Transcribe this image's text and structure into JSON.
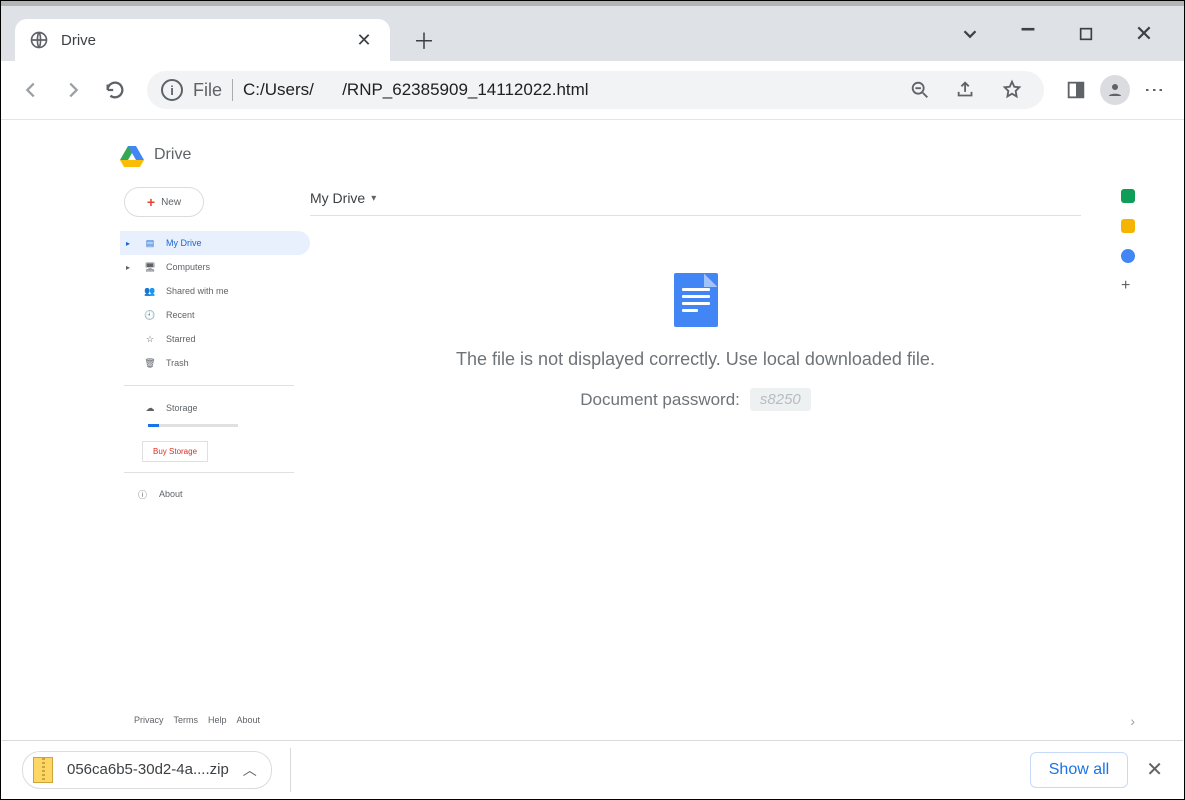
{
  "window": {
    "tab_title": "Drive"
  },
  "omnibox": {
    "scheme": "File",
    "url": "C:/Users/      /RNP_62385909_14112022.html"
  },
  "drive": {
    "brand": "Drive",
    "new_button": "New",
    "breadcrumb": "My Drive",
    "nav": {
      "my_drive": "My Drive",
      "computers": "Computers",
      "shared": "Shared with me",
      "recent": "Recent",
      "starred": "Starred",
      "trash": "Trash",
      "storage": "Storage",
      "buy_storage": "Buy Storage",
      "about": "About"
    },
    "footer": {
      "privacy": "Privacy",
      "terms": "Terms",
      "help": "Help",
      "about": "About"
    },
    "message": "The file is not displayed correctly. Use local downloaded file.",
    "password_label": "Document password:",
    "password_value": "s8250"
  },
  "downloads": {
    "filename": "056ca6b5-30d2-4a....zip",
    "show_all": "Show all"
  }
}
